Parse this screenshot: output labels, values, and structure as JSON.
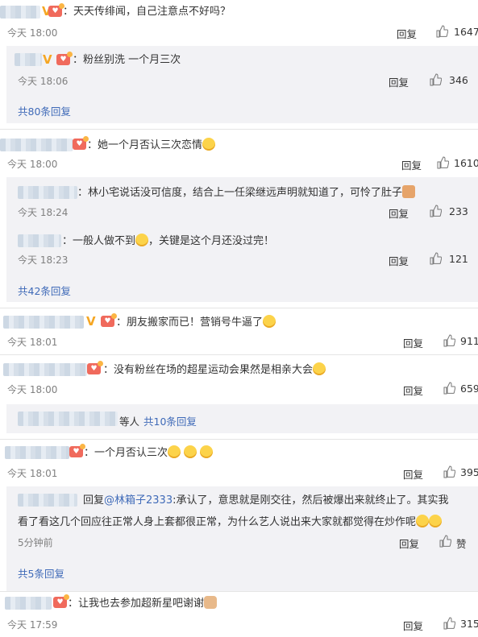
{
  "c1": {
    "text": "：天天传绯闻，自己注意点不好吗？",
    "time": "今天 18:00",
    "reply": "回复",
    "likes": "1647"
  },
  "c1r1": {
    "text": "：粉丝别洗 一个月三次",
    "time": "今天 18:06",
    "reply": "回复",
    "likes": "346"
  },
  "c1more": "共80条回复",
  "c2": {
    "text": "：她一个月否认三次恋情",
    "time": "今天 18:00",
    "reply": "回复",
    "likes": "1610"
  },
  "c2r1": {
    "text": "：林小宅说话没可信度，结合上一任梁继远声明就知道了，可怜了肚子",
    "time": "今天 18:24",
    "reply": "回复",
    "likes": "233"
  },
  "c2r2": {
    "text_a": "：一般人做不到",
    "text_b": "，关键是这个月还没过完！",
    "time": "今天 18:23",
    "reply": "回复",
    "likes": "121"
  },
  "c2more": "共42条回复",
  "c3": {
    "text": "：朋友搬家而已！营销号牛逼了",
    "time": "今天 18:01",
    "reply": "回复",
    "likes": "911"
  },
  "c4": {
    "text": "：没有粉丝在场的超星运动会果然是相亲大会",
    "time": "今天 18:00",
    "reply": "回复",
    "likes": "659"
  },
  "c4more": {
    "prefix": "等人",
    "link": "共10条回复"
  },
  "c5": {
    "text": "：一个月否认三次",
    "time": "今天 18:01",
    "reply": "回复",
    "likes": "395"
  },
  "c5r1": {
    "reply_label": "回复",
    "mention": "@林箱子2333",
    "line1": ":承认了，意思就是刚交往，然后被爆出来就终止了。其实我",
    "line2": "看了看这几个回应往正常人身上套都很正常，为什么艺人说出来大家就都觉得在炒作呢",
    "time": "5分钟前",
    "reply": "回复",
    "likes": "赞"
  },
  "c5more": "共5条回复",
  "c6": {
    "text": "：让我也去参加超新星吧谢谢",
    "time": "今天 17:59",
    "reply": "回复",
    "likes": "315"
  }
}
